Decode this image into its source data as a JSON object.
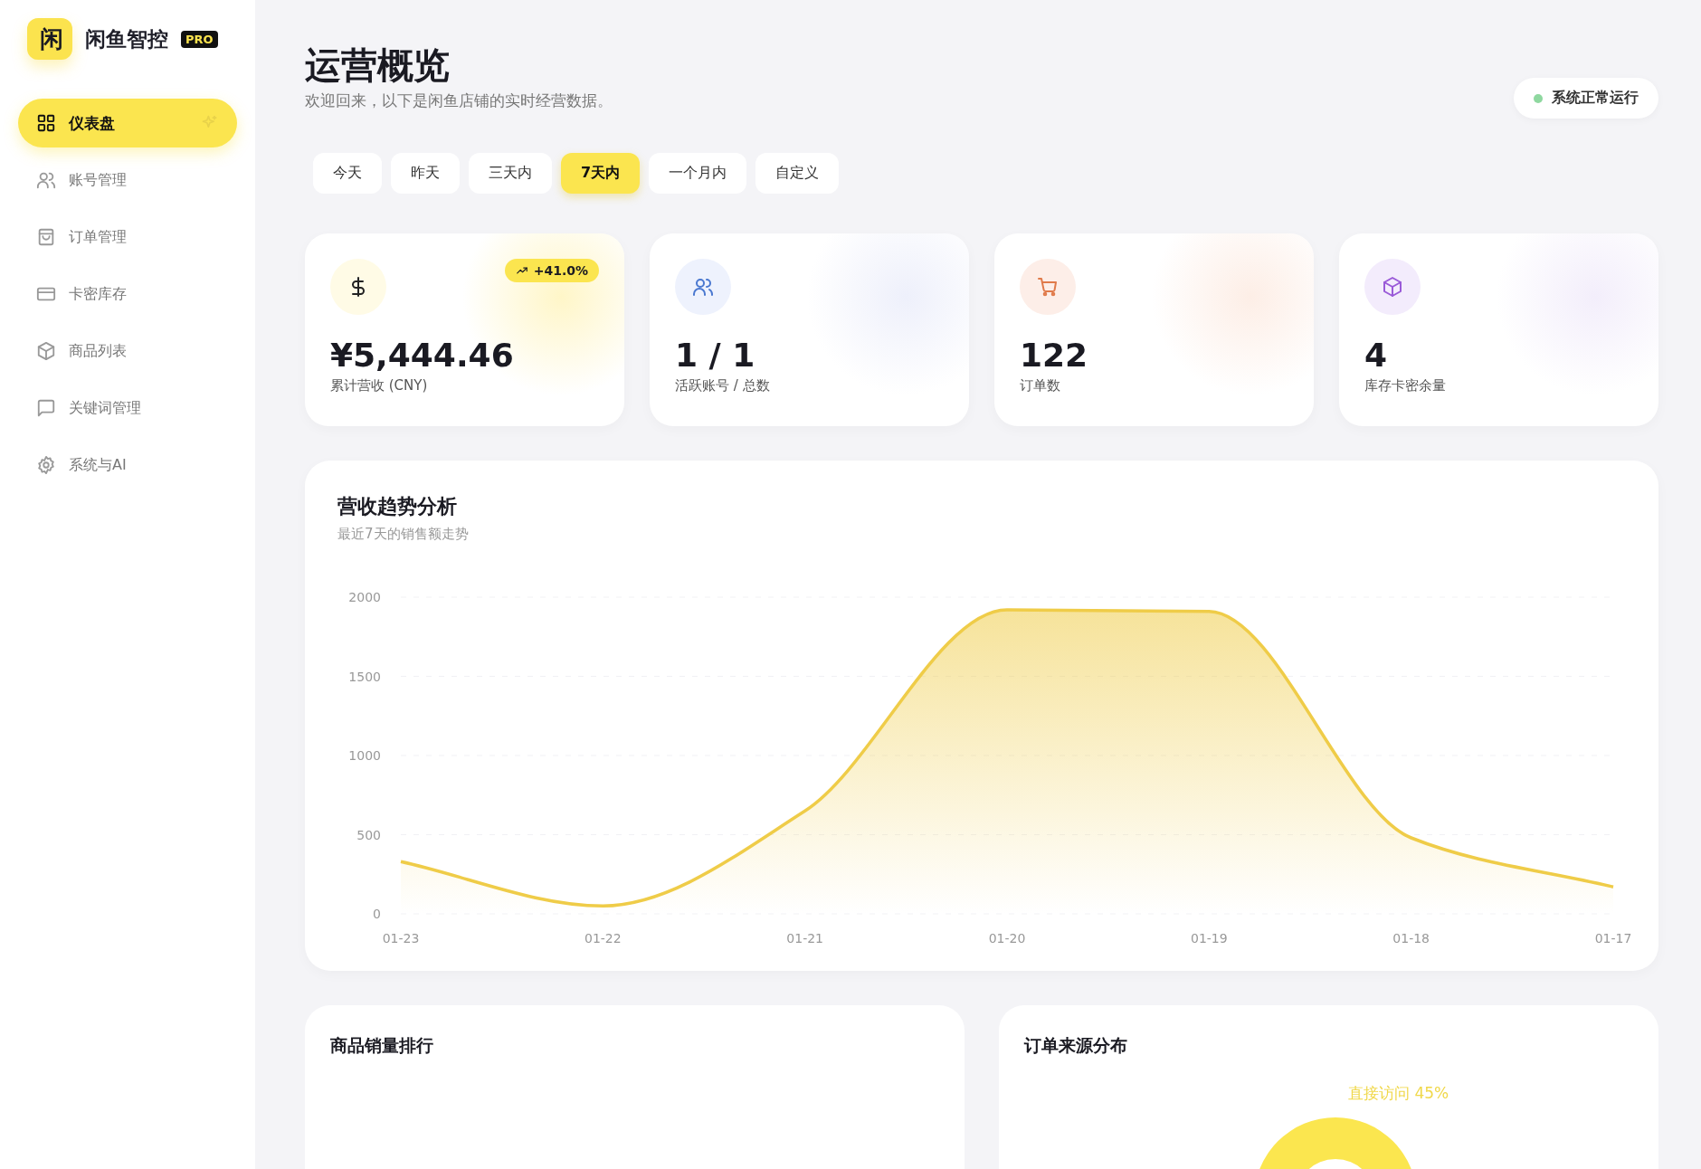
{
  "sidebar": {
    "logo_glyph": "闲",
    "brand": "闲鱼智控",
    "badge": "PRO",
    "items": [
      {
        "label": "仪表盘",
        "selected": true
      },
      {
        "label": "账号管理",
        "selected": false
      },
      {
        "label": "订单管理",
        "selected": false
      },
      {
        "label": "卡密库存",
        "selected": false
      },
      {
        "label": "商品列表",
        "selected": false
      },
      {
        "label": "关键词管理",
        "selected": false
      },
      {
        "label": "系统与AI",
        "selected": false
      }
    ]
  },
  "header": {
    "title": "运营概览",
    "subtitle": "欢迎回来，以下是闲鱼店铺的实时经营数据。",
    "status": "系统正常运行"
  },
  "range_tabs": [
    {
      "label": "今天",
      "selected": false
    },
    {
      "label": "昨天",
      "selected": false
    },
    {
      "label": "三天内",
      "selected": false
    },
    {
      "label": "7天内",
      "selected": true
    },
    {
      "label": "一个月内",
      "selected": false
    },
    {
      "label": "自定义",
      "selected": false
    }
  ],
  "stats": [
    {
      "value": "¥5,444.46",
      "label": "累计营收 (CNY)",
      "trend": "+41.0%"
    },
    {
      "value": "1 / 1",
      "label": "活跃账号 / 总数"
    },
    {
      "value": "122",
      "label": "订单数"
    },
    {
      "value": "4",
      "label": "库存卡密余量"
    }
  ],
  "revenue_chart": {
    "title": "营收趋势分析",
    "subtitle": "最近7天的销售额走势",
    "chart_data": {
      "type": "area",
      "categories": [
        "01-23",
        "01-22",
        "01-21",
        "01-20",
        "01-19",
        "01-18",
        "01-17"
      ],
      "series": [
        {
          "color": "#efcc48",
          "values": [
            330,
            50,
            650,
            1920,
            1910,
            480,
            170
          ]
        }
      ],
      "ylim": [
        0,
        2000
      ],
      "yticks": [
        0,
        500,
        1000,
        1500,
        2000
      ],
      "grid": true
    }
  },
  "sales_ranking": {
    "title": "商品销量排行"
  },
  "order_sources": {
    "title": "订单来源分布",
    "slice_label": "直接访问 45%"
  }
}
